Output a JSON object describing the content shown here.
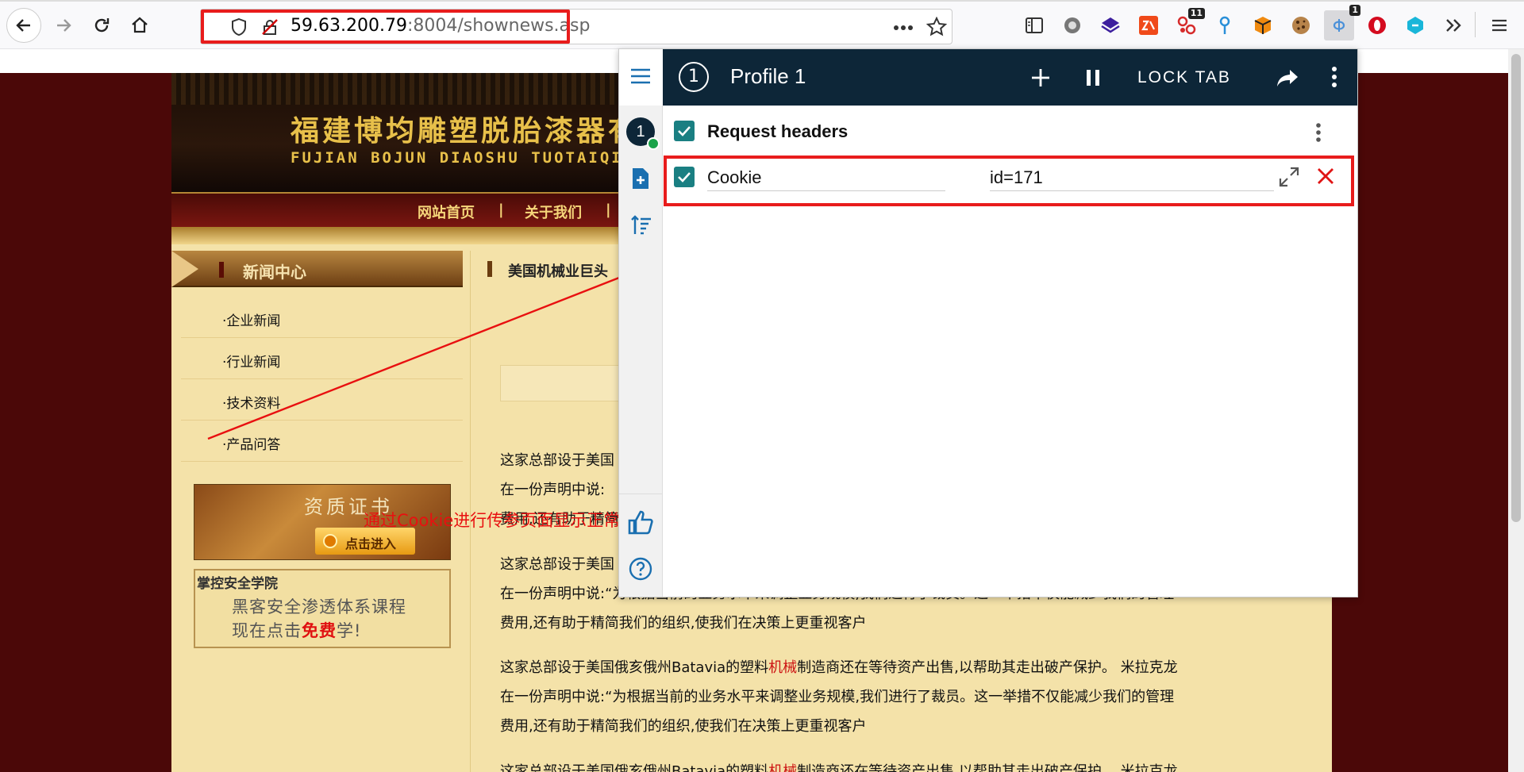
{
  "browser": {
    "url_host": "59.63.200.79",
    "url_rest": ":8004/shownews.asp",
    "ext_badges": {
      "multi": "11",
      "header": "1"
    }
  },
  "site": {
    "title_cn": "福建博均雕塑脱胎漆器有限",
    "title_en": "FUJIAN BOJUN DIAOSHU  TUOTAIQIQU  LIMIT",
    "nav": [
      "网站首页",
      "|",
      "关于我们",
      "|"
    ],
    "sidebar_title": "新闻中心",
    "sidebar_items": [
      "·企业新闻",
      "·行业新闻",
      "·技术资料",
      "·产品问答"
    ],
    "cert_title": "资质证书",
    "cert_button": "点击进入",
    "ad_line1": "掌控安全学院",
    "ad_line2": "黑客安全渗透体系课程",
    "ad_line3_pre": "现在点击",
    "ad_line3_red": "免费",
    "ad_line3_post": "学!",
    "news_title": "美国机械业巨头",
    "para1": "这家总部设于美国",
    "para1_l2": "在一份声明中说:",
    "para1_l3": "费用,还有助于精简",
    "para2_l1": "这家总部设于美国",
    "para2_l2": "在一份声明中说:“为根据当前的业务水平来调整业务规模,我们进行了裁员。这一举措不仅能减少我们的管理",
    "para2_l3": "费用,还有助于精简我们的组织,使我们在决策上更重视客户",
    "para3_l1_pre": "这家总部设于美国俄亥俄州Batavia的塑料",
    "para3_l1_red": "机械",
    "para3_l1_post": "制造商还在等待资产出售,以帮助其走出破产保护。 米拉克龙",
    "para3_l2": "在一份声明中说:“为根据当前的业务水平来调整业务规模,我们进行了裁员。这一举措不仅能减少我们的管理",
    "para3_l3": "费用,还有助于精简我们的组织,使我们在决策上更重视客户",
    "para4_l1_pre": "这家总部设于美国俄亥俄州Batavia的塑料",
    "para4_l1_red": "机械",
    "para4_l1_post": "制造商还在等待资产出售,以帮助其走出破产保护。 米拉克龙"
  },
  "annotation": "通过Cookie进行传参页面显示正常",
  "popup": {
    "profile_number": "1",
    "profile_name": "Profile 1",
    "lock_tab": "LOCK TAB",
    "section_title": "Request headers",
    "header_name": "Cookie",
    "header_value": "id=171",
    "rail_badge": "1"
  },
  "colors": {
    "popup_header": "#0d2638",
    "checkbox": "#1a7f82",
    "highlight": "#e81c1c",
    "page_bg": "#4b0808",
    "site_bg": "#f4e2a9"
  }
}
